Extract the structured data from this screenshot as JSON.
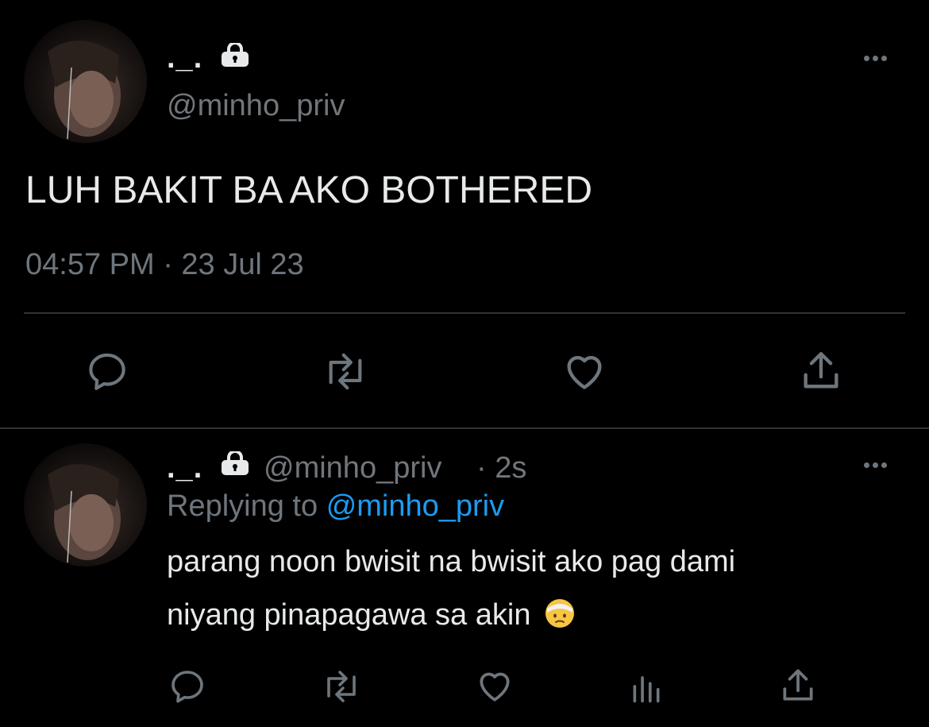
{
  "main_tweet": {
    "display_name": "._.",
    "handle": "@minho_priv",
    "text": "LUH BAKIT BA AKO BOTHERED",
    "timestamp": "04:57 PM · 23 Jul 23"
  },
  "reply_tweet": {
    "display_name": "._.",
    "handle": "@minho_priv",
    "time": "· 2s",
    "replying_prefix": "Replying to",
    "replying_handle": "@minho_priv",
    "text_line1": "parang noon bwisit na bwisit ako pag dami",
    "text_line2": "niyang pinapagawa sa akin",
    "emoji": "🤕"
  },
  "colors": {
    "background": "#000000",
    "text": "#e7e9ea",
    "muted": "#6e767d",
    "link": "#1d9bf0",
    "divider": "#2f3336"
  },
  "icons": {
    "lock": "lock-icon",
    "more": "more-icon",
    "reply": "reply-icon",
    "retweet": "retweet-icon",
    "like": "like-icon",
    "views": "views-icon",
    "share": "share-icon"
  }
}
